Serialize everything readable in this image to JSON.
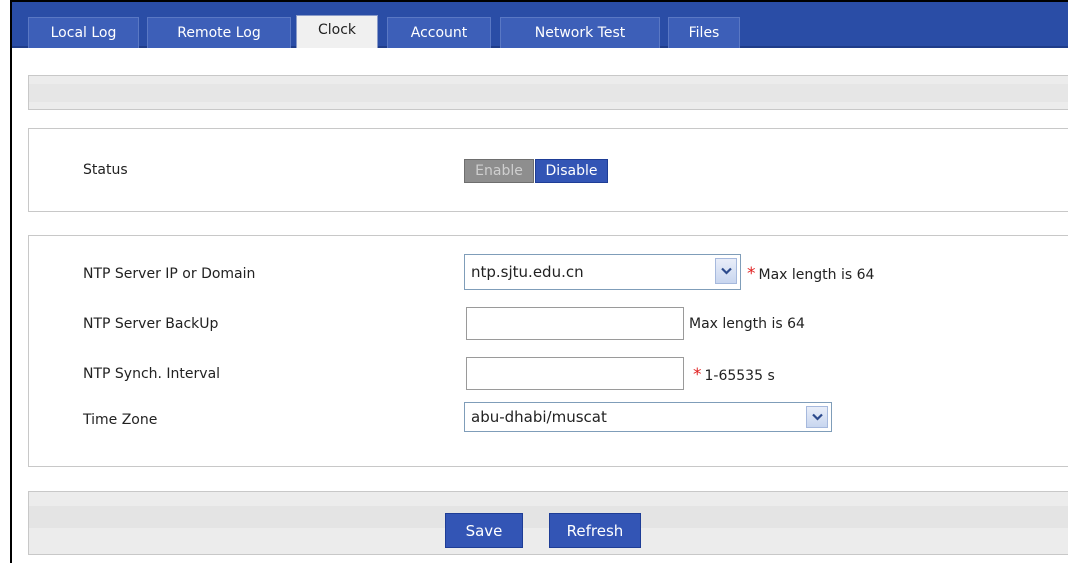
{
  "tabs": [
    {
      "label": "Local Log"
    },
    {
      "label": "Remote Log"
    },
    {
      "label": "Clock",
      "active": true
    },
    {
      "label": "Account"
    },
    {
      "label": "Network Test"
    },
    {
      "label": "Files"
    }
  ],
  "status": {
    "label": "Status",
    "enable_label": "Enable",
    "disable_label": "Disable",
    "selected": "Disable"
  },
  "ntp": {
    "server": {
      "label": "NTP Server IP or Domain",
      "value": "ntp.sjtu.edu.cn",
      "hint": "Max length is 64",
      "required": "*"
    },
    "backup": {
      "label": "NTP Server BackUp",
      "value": "",
      "hint": "Max length is 64"
    },
    "interval": {
      "label": "NTP Synch. Interval",
      "value": "",
      "hint": "1-65535 s",
      "required": "*"
    },
    "timezone": {
      "label": "Time Zone",
      "value": "abu-dhabi/muscat"
    }
  },
  "actions": {
    "save_label": "Save",
    "refresh_label": "Refresh"
  },
  "colors": {
    "tabbar": "#2a4da6",
    "button": "#3355b5",
    "required": "#e02020"
  }
}
